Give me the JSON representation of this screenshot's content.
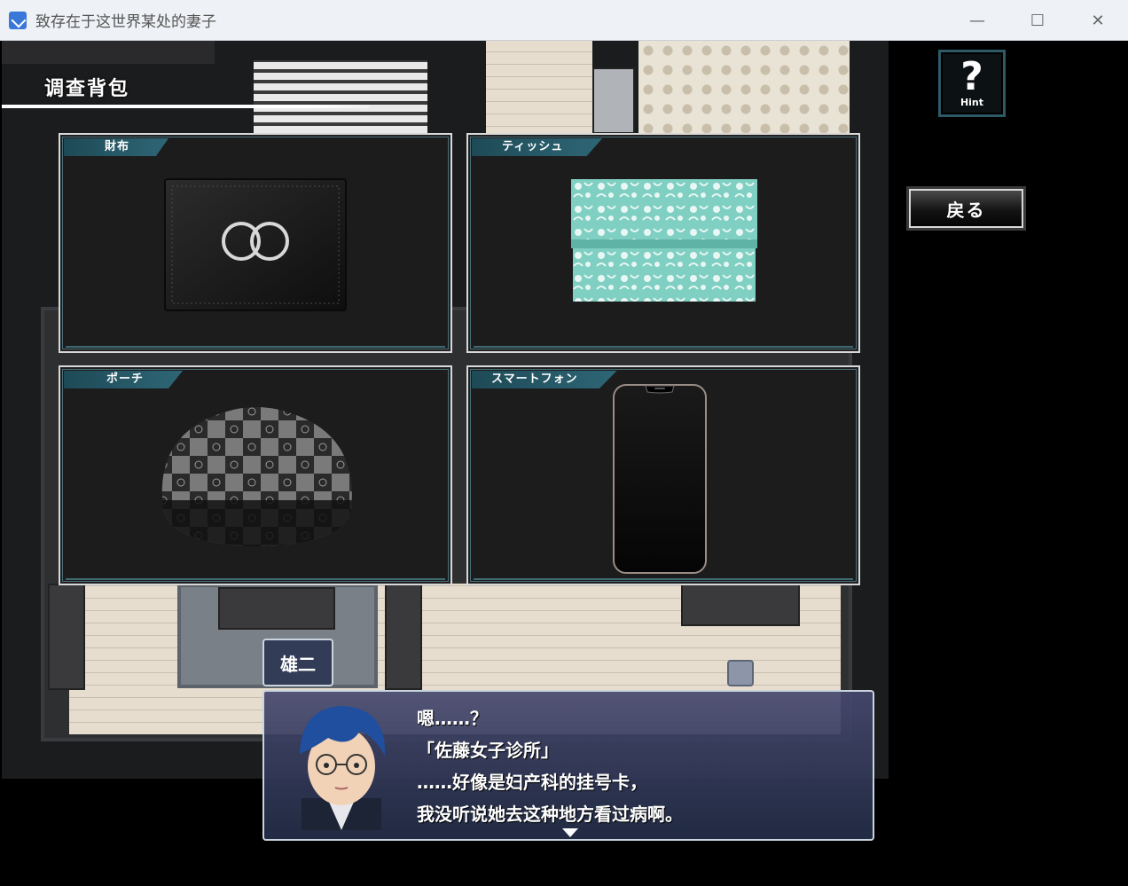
{
  "window": {
    "title": "致存在于这世界某处的妻子",
    "minimize": "—",
    "maximize": "☐",
    "close": "✕"
  },
  "header": {
    "title": "调查背包"
  },
  "items": [
    {
      "label": "財布",
      "icon": "wallet-icon"
    },
    {
      "label": "ティッシュ",
      "icon": "tissue-icon"
    },
    {
      "label": "ポーチ",
      "icon": "pouch-icon"
    },
    {
      "label": "スマートフォン",
      "icon": "smartphone-icon"
    }
  ],
  "hint": {
    "label": "Hint",
    "icon": "question-icon",
    "glyph": "?"
  },
  "back": {
    "label": "戻る"
  },
  "dialogue": {
    "speaker": "雄二",
    "lines": [
      "嗯……？",
      "「佐藤女子诊所」",
      "……好像是妇产科的挂号卡，",
      "我没听说她去这种地方看过病啊。"
    ]
  },
  "colors": {
    "panel_tab": "#2e6676",
    "panel_bg": "#1c1c1d",
    "tissue": "#7fcfc2",
    "dialog_bg": "#3a3f62"
  }
}
